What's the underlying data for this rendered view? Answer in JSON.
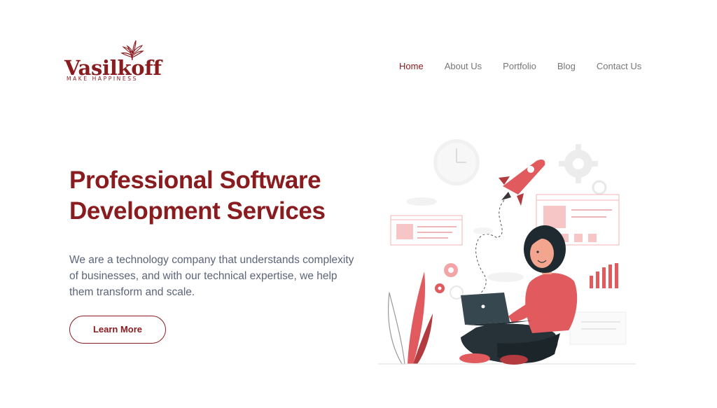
{
  "brand": {
    "name": "Vasilkoff",
    "tagline": "MAKE HAPPINESS",
    "color": "#8a1c20"
  },
  "nav": {
    "items": [
      {
        "label": "Home",
        "active": true
      },
      {
        "label": "About Us",
        "active": false
      },
      {
        "label": "Portfolio",
        "active": false
      },
      {
        "label": "Blog",
        "active": false
      },
      {
        "label": "Contact Us",
        "active": false
      }
    ]
  },
  "hero": {
    "title_line1": "Professional Software",
    "title_line2": "Development Services",
    "desc_line1": "We are a technology company that understands complexity",
    "desc_line2": "of businesses, and with our technical expertise, we help",
    "desc_line3": "them transform and scale.",
    "cta_label": "Learn More"
  },
  "illustration": {
    "subject": "woman-with-laptop",
    "accent_color": "#e05a5e"
  }
}
